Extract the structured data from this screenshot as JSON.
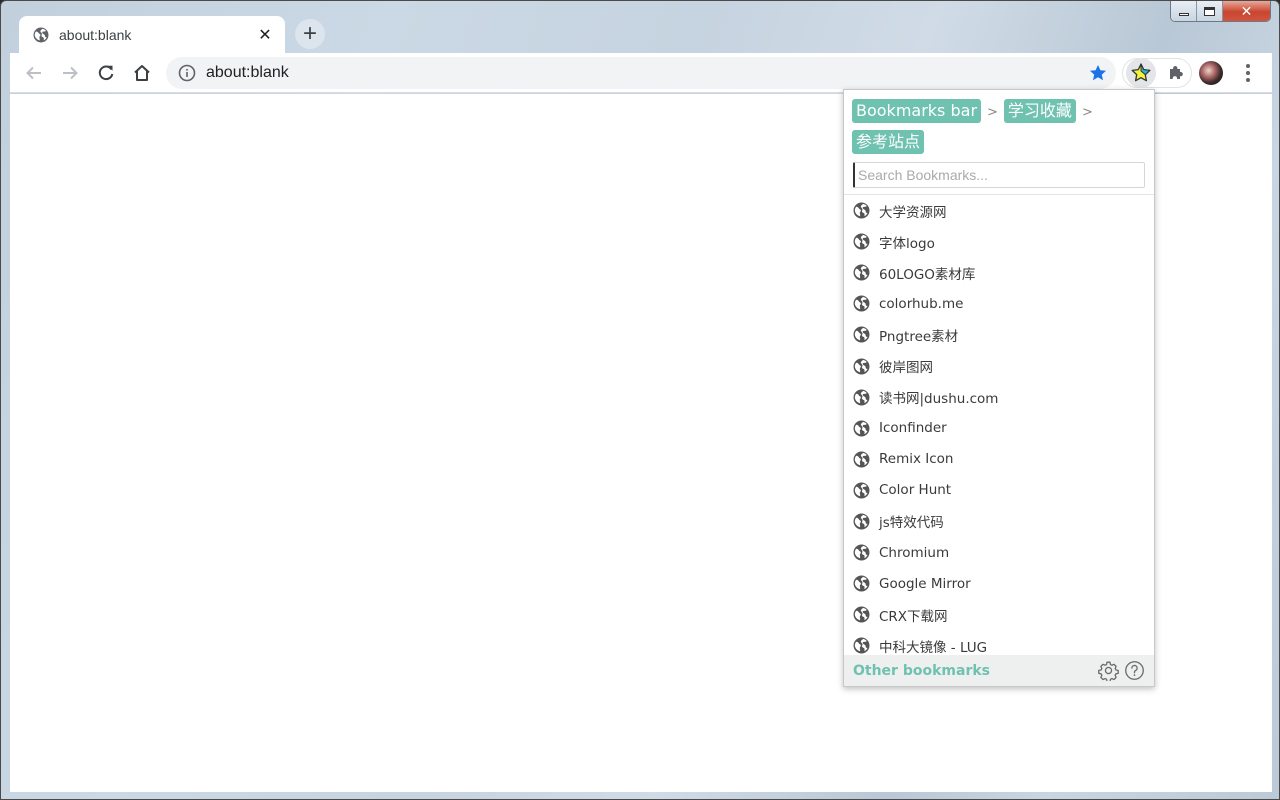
{
  "window": {
    "caption": {
      "minimize": "minimize",
      "maximize": "maximize",
      "close": "close"
    }
  },
  "tabs": [
    {
      "title": "about:blank",
      "icon": "globe-icon",
      "active": true
    }
  ],
  "tab_strip": {
    "new_tab_icon": "plus-icon",
    "close_glyph": "✕",
    "new_tab_glyph": "+"
  },
  "toolbar": {
    "back_icon": "arrow-left-icon",
    "forward_icon": "arrow-right-icon",
    "reload_icon": "reload-icon",
    "home_icon": "home-icon",
    "url": "about:blank",
    "bookmark_star_icon": "star-filled-icon",
    "extensions": [
      {
        "name": "bookmark-extension",
        "icon": "star-colored-icon",
        "active": true
      },
      {
        "name": "extensions-menu",
        "icon": "puzzle-icon",
        "active": false
      }
    ],
    "profile": "avatar",
    "menu_icon": "kebab-menu-icon"
  },
  "popup": {
    "accent_color": "#6fc1b0",
    "breadcrumb": [
      {
        "label": "Bookmarks bar"
      },
      {
        "label": "学习收藏"
      },
      {
        "label": "参考站点"
      }
    ],
    "breadcrumb_separator": ">",
    "search": {
      "placeholder": "Search Bookmarks...",
      "value": ""
    },
    "items": [
      {
        "label": "大学资源网"
      },
      {
        "label": "字体logo"
      },
      {
        "label": "60LOGO素材库"
      },
      {
        "label": "colorhub.me"
      },
      {
        "label": "Pngtree素材"
      },
      {
        "label": "彼岸图网"
      },
      {
        "label": "读书网|dushu.com"
      },
      {
        "label": "Iconfinder"
      },
      {
        "label": "Remix Icon"
      },
      {
        "label": "Color Hunt"
      },
      {
        "label": "js特效代码"
      },
      {
        "label": "Chromium"
      },
      {
        "label": "Google Mirror"
      },
      {
        "label": "CRX下载网"
      },
      {
        "label": "中科大镜像 - LUG"
      }
    ],
    "footer": {
      "other_bookmarks": "Other bookmarks",
      "settings_icon": "gear-icon",
      "help_icon": "help-circle-icon"
    }
  }
}
